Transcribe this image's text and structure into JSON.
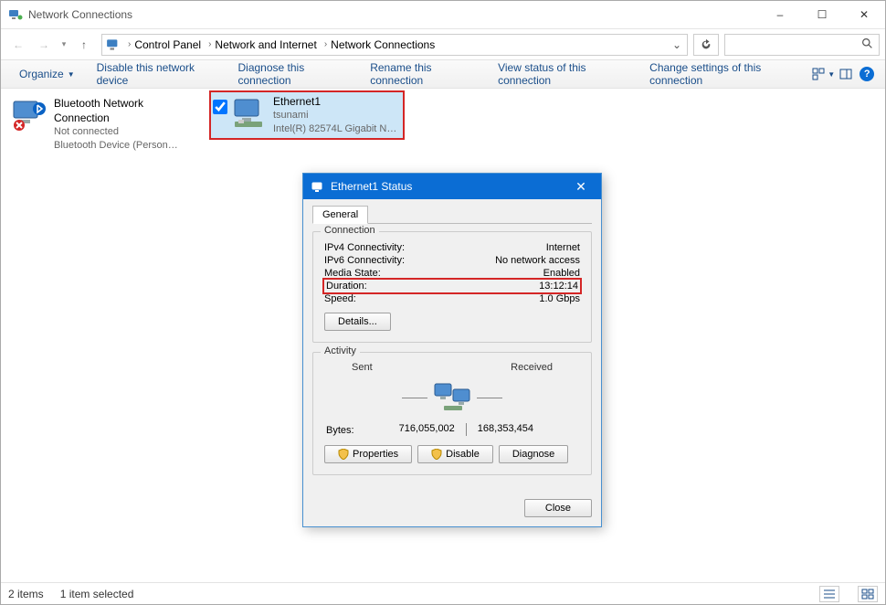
{
  "window": {
    "title": "Network Connections",
    "minimize": "–",
    "maximize": "☐",
    "close": "✕"
  },
  "breadcrumb": {
    "root": "Control Panel",
    "mid": "Network and Internet",
    "leaf": "Network Connections"
  },
  "search": {
    "placeholder": ""
  },
  "commands": {
    "organize": "Organize",
    "disable": "Disable this network device",
    "diagnose": "Diagnose this connection",
    "rename": "Rename this connection",
    "viewstatus": "View status of this connection",
    "changeset": "Change settings of this connection"
  },
  "connections": [
    {
      "name": "Bluetooth Network Connection",
      "line2": "Not connected",
      "line3": "Bluetooth Device (Personal Ar...",
      "selected": false,
      "kind": "bluetooth"
    },
    {
      "name": "Ethernet1",
      "line2": "tsunami",
      "line3": "Intel(R) 82574L Gigabit Netwo...",
      "selected": true,
      "kind": "ethernet"
    }
  ],
  "status_dialog": {
    "title": "Ethernet1 Status",
    "tab_general": "General",
    "group_connection": "Connection",
    "rows": {
      "ipv4_l": "IPv4 Connectivity:",
      "ipv4_v": "Internet",
      "ipv6_l": "IPv6 Connectivity:",
      "ipv6_v": "No network access",
      "media_l": "Media State:",
      "media_v": "Enabled",
      "dur_l": "Duration:",
      "dur_v": "13:12:14",
      "speed_l": "Speed:",
      "speed_v": "1.0 Gbps"
    },
    "details_btn": "Details...",
    "group_activity": "Activity",
    "activity": {
      "sent_label": "Sent",
      "recv_label": "Received",
      "bytes_label": "Bytes:",
      "sent_bytes": "716,055,002",
      "recv_bytes": "168,353,454"
    },
    "buttons": {
      "properties": "Properties",
      "disable": "Disable",
      "diagnose": "Diagnose",
      "close": "Close"
    }
  },
  "statusbar": {
    "count": "2 items",
    "selected": "1 item selected"
  }
}
